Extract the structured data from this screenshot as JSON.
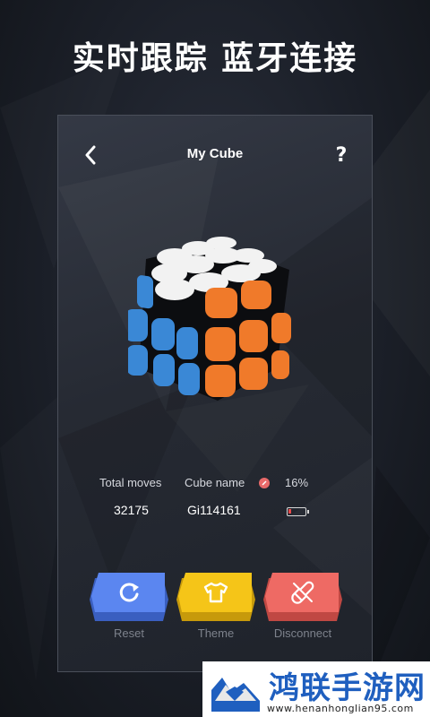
{
  "headline": "实时跟踪  蓝牙连接",
  "topbar": {
    "title": "My Cube",
    "back_icon": "chevron-left-icon",
    "help_icon": "question-icon",
    "help_glyph": "?"
  },
  "stats": {
    "total_moves_label": "Total moves",
    "total_moves_value": "32175",
    "cube_name_label": "Cube name",
    "cube_name_value": "Gi114161",
    "battery_percent_label": "16%",
    "battery_level": 0.16,
    "battery_color": "#e84a4a",
    "link_color": "#e86a6a"
  },
  "actions": [
    {
      "label": "Reset",
      "icon": "reset-icon",
      "color": "#5b86f0",
      "shadow": "#3a5fc0"
    },
    {
      "label": "Theme",
      "icon": "tshirt-icon",
      "color": "#f5c518",
      "shadow": "#c79a0b"
    },
    {
      "label": "Disconnect",
      "icon": "unlink-icon",
      "color": "#ee6a64",
      "shadow": "#c04843"
    }
  ],
  "watermark": {
    "text": "鸿联手游网",
    "url": "www.henanhonglian95.com"
  }
}
